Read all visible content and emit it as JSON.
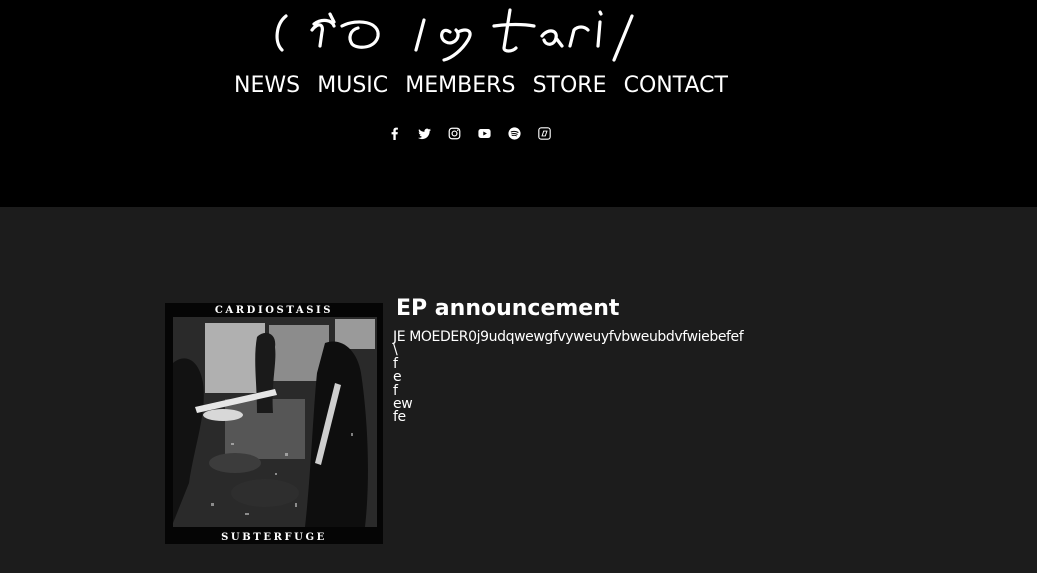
{
  "header": {
    "logo_text": "cardiostasis",
    "nav": [
      {
        "label": "NEWS"
      },
      {
        "label": "MUSIC"
      },
      {
        "label": "MEMBERS"
      },
      {
        "label": "STORE"
      },
      {
        "label": "CONTACT"
      }
    ],
    "social_icons": [
      "facebook-icon",
      "twitter-icon",
      "instagram-icon",
      "youtube-icon",
      "spotify-icon",
      "bandcamp-icon"
    ]
  },
  "post": {
    "title": "EP announcement",
    "cover": {
      "top_text": "CARDIOSTASIS",
      "bottom_text": "SUBTERFUGE"
    },
    "body_lines": [
      "JE MOEDER0j9udqwewgfvyweuyfvbweubdvfwiebefef",
      "\\",
      "f",
      "e",
      "f",
      "ew",
      "fe"
    ]
  },
  "colors": {
    "header_bg": "#000000",
    "page_bg": "#1c1c1c",
    "text": "#ffffff"
  }
}
